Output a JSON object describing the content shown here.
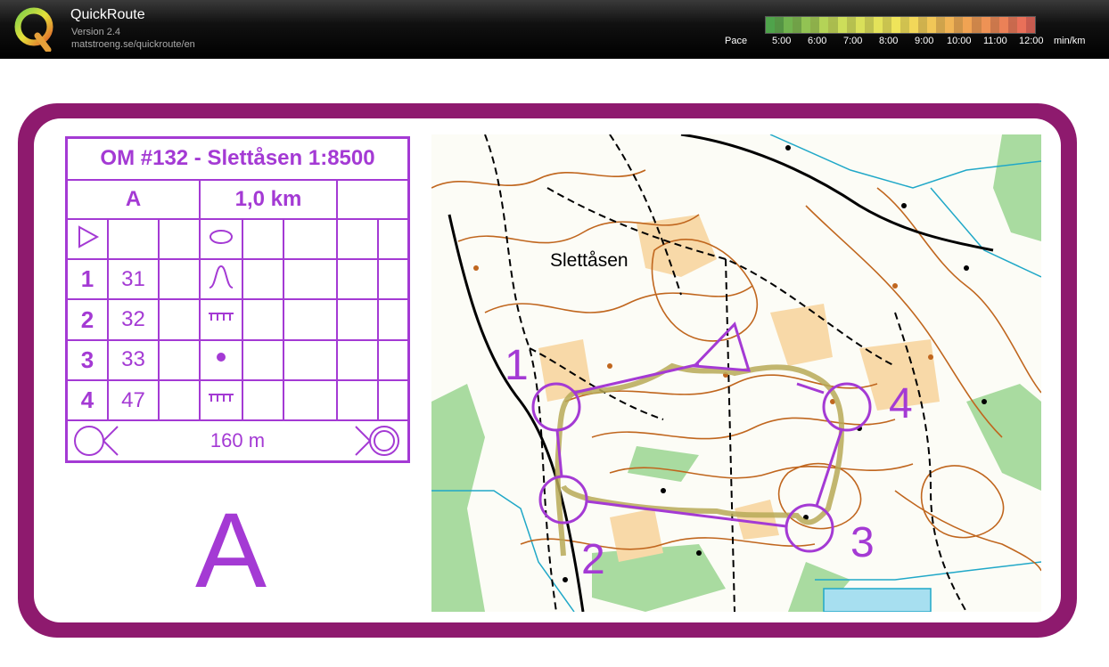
{
  "app": {
    "title": "QuickRoute",
    "version": "Version 2.4",
    "url": "matstroeng.se/quickroute/en"
  },
  "pace": {
    "label": "Pace",
    "ticks": [
      "5:00",
      "6:00",
      "7:00",
      "8:00",
      "9:00",
      "10:00",
      "11:00",
      "12:00",
      "min/km"
    ],
    "colors": [
      "#4fa34b",
      "#c9dd5a",
      "#f2e45a",
      "#f0a553",
      "#e8685a"
    ]
  },
  "course": {
    "title": "OM #132 - Slettåsen 1:8500",
    "class": "A",
    "length": "1,0 km",
    "controls": [
      {
        "number": "1",
        "code": "31",
        "symbol": "knoll"
      },
      {
        "number": "2",
        "code": "32",
        "symbol": "cliff"
      },
      {
        "number": "3",
        "code": "33",
        "symbol": "dot"
      },
      {
        "number": "4",
        "code": "47",
        "symbol": "cliff"
      }
    ],
    "finish_distance": "160 m",
    "big_label": "A"
  },
  "map": {
    "place_name": "Slettåsen",
    "control_labels": [
      "1",
      "2",
      "3",
      "4"
    ],
    "colors": {
      "course": "#a43ad4",
      "route": "#b7a957",
      "contour": "#c0661e",
      "water": "#20a8c8",
      "green": "#8fd08a",
      "yellow": "#f6c98a"
    }
  }
}
